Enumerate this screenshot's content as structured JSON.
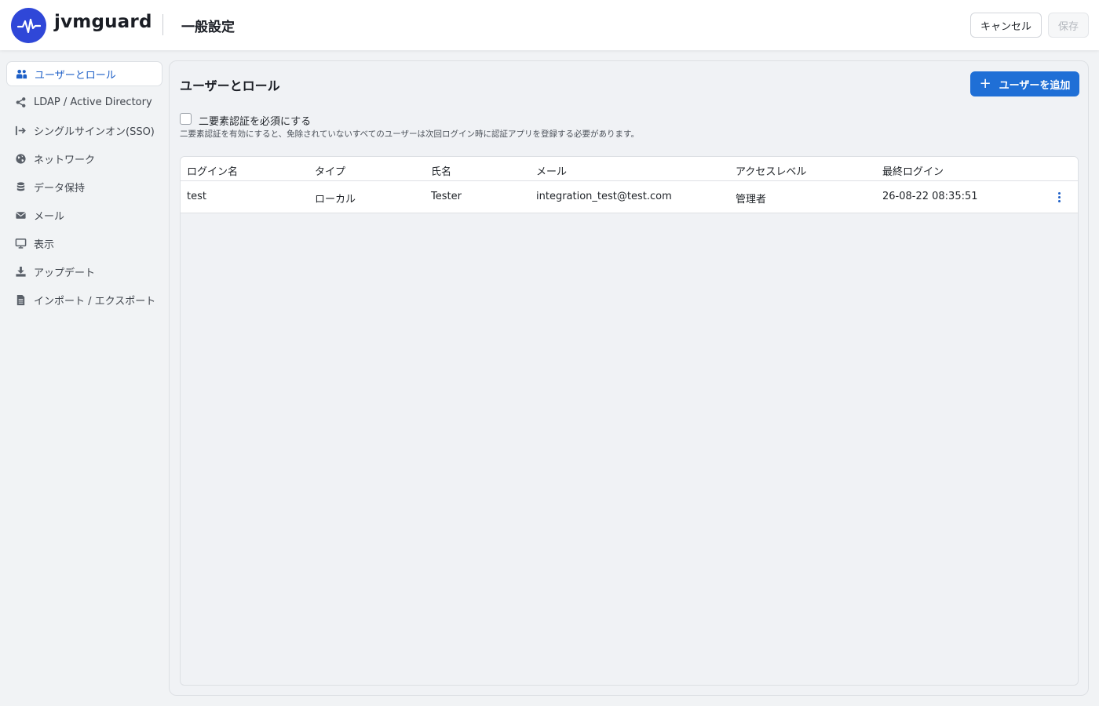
{
  "header": {
    "brand": "jvmguard",
    "page_title": "一般設定",
    "cancel_label": "キャンセル",
    "save_label": "保存"
  },
  "sidebar": {
    "items": [
      {
        "label": "ユーザーとロール",
        "icon": "users-icon",
        "active": true
      },
      {
        "label": "LDAP / Active Directory",
        "icon": "share-icon"
      },
      {
        "label": "シングルサインオン(SSO)",
        "icon": "sign-in-icon"
      },
      {
        "label": "ネットワーク",
        "icon": "globe-icon"
      },
      {
        "label": "データ保持",
        "icon": "database-icon"
      },
      {
        "label": "メール",
        "icon": "envelope-icon"
      },
      {
        "label": "表示",
        "icon": "monitor-icon"
      },
      {
        "label": "アップデート",
        "icon": "download-icon"
      },
      {
        "label": "インポート / エクスポート",
        "icon": "file-icon"
      }
    ]
  },
  "main": {
    "section_title": "ユーザーとロール",
    "add_user_label": "ユーザーを追加",
    "two_factor": {
      "label": "二要素認証を必須にする",
      "description": "二要素認証を有効にすると、免除されていないすべてのユーザーは次回ログイン時に認証アプリを登録する必要があります。",
      "checked": false
    },
    "table": {
      "headers": {
        "login": "ログイン名",
        "type": "タイプ",
        "name": "氏名",
        "email": "メール",
        "access": "アクセスレベル",
        "last_login": "最終ログイン"
      },
      "rows": [
        {
          "login": "test",
          "type": "ローカル",
          "name": "Tester",
          "email": "integration_test@test.com",
          "access": "管理者",
          "last_login": "26-08-22 08:35:51"
        }
      ]
    }
  },
  "colors": {
    "accent": "#1f6fd6",
    "logo": "#2f47d8",
    "active_text": "#1d5fc7"
  }
}
